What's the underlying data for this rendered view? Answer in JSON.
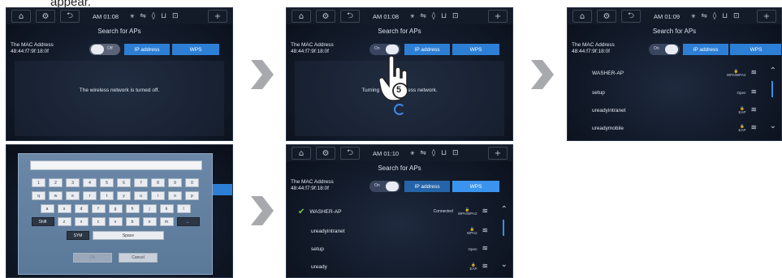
{
  "intro_text": "appear.",
  "statusbar_icons": {
    "home": "⌂",
    "settings": "⚙",
    "back": "⮌",
    "plus": "+"
  },
  "screens": [
    {
      "time": "AM 01:08",
      "icons": "⚹ ⇋ ◊ ⊔ ⊡",
      "title": "Search for APs",
      "mac_label": "The MAC Address",
      "mac_value": "48:44:f7:9f:18:0f",
      "toggle": "Off",
      "ip_tab": "IP address",
      "wps_tab": "WPS",
      "message": "The wireless network is turned off."
    },
    {
      "time": "AM 01:08",
      "icons": "⚹ ⇋ ◊ ⊔ ⊡",
      "title": "Search for APs",
      "mac_label": "The MAC Address",
      "mac_value": "48:44:f7:9f:18:0f",
      "toggle": "On",
      "ip_tab": "IP address",
      "wps_tab": "WPS",
      "message": "Turning on the wireless network.",
      "step": "5"
    },
    {
      "time": "AM 01:09",
      "icons": "⚹ ⇋ ◊ ⊔ ⊡",
      "title": "Search for APs",
      "mac_label": "The MAC Address",
      "mac_value": "48:44:f7:9f:18:0f",
      "toggle": "On",
      "ip_tab": "IP address",
      "wps_tab": "WPS",
      "aps": [
        {
          "name": "WASHER-AP",
          "security": "WPA/WPA2"
        },
        {
          "name": "setup",
          "security": "Open"
        },
        {
          "name": "ureadyintranet",
          "security": "EAP"
        },
        {
          "name": "ureadymobile",
          "security": "EAP"
        }
      ]
    },
    {
      "keyboard": {
        "row1": [
          "1",
          "2",
          "3",
          "4",
          "5",
          "6",
          "7",
          "8",
          "9",
          "0"
        ],
        "row2": [
          "q",
          "w",
          "e",
          "r",
          "t",
          "y",
          "u",
          "i",
          "o",
          "p"
        ],
        "row3": [
          "a",
          "s",
          "d",
          "f",
          "g",
          "h",
          "j",
          "k",
          "l"
        ],
        "row4": [
          "Shift",
          "z",
          "x",
          "c",
          "v",
          "b",
          "n",
          "m",
          "←"
        ],
        "sym": "SYM",
        "space": "Space",
        "ok": "OK",
        "cancel": "Cancel"
      }
    },
    {
      "time": "AM 01:10",
      "icons": "⚹ ⇋ ◊ ⊔ ⊡",
      "title": "Search for APs",
      "mac_label": "The MAC Address",
      "mac_value": "48:44:f7:9f:18:0f",
      "toggle": "On",
      "ip_tab": "IP address",
      "wps_tab": "WPS",
      "aps": [
        {
          "name": "WASHER-AP",
          "security": "WPA/WPA2",
          "status": "Connected"
        },
        {
          "name": "ureadyintranet",
          "security": "WPA2"
        },
        {
          "name": "setup",
          "security": "Open"
        },
        {
          "name": "uready",
          "security": "EAP"
        }
      ]
    }
  ]
}
